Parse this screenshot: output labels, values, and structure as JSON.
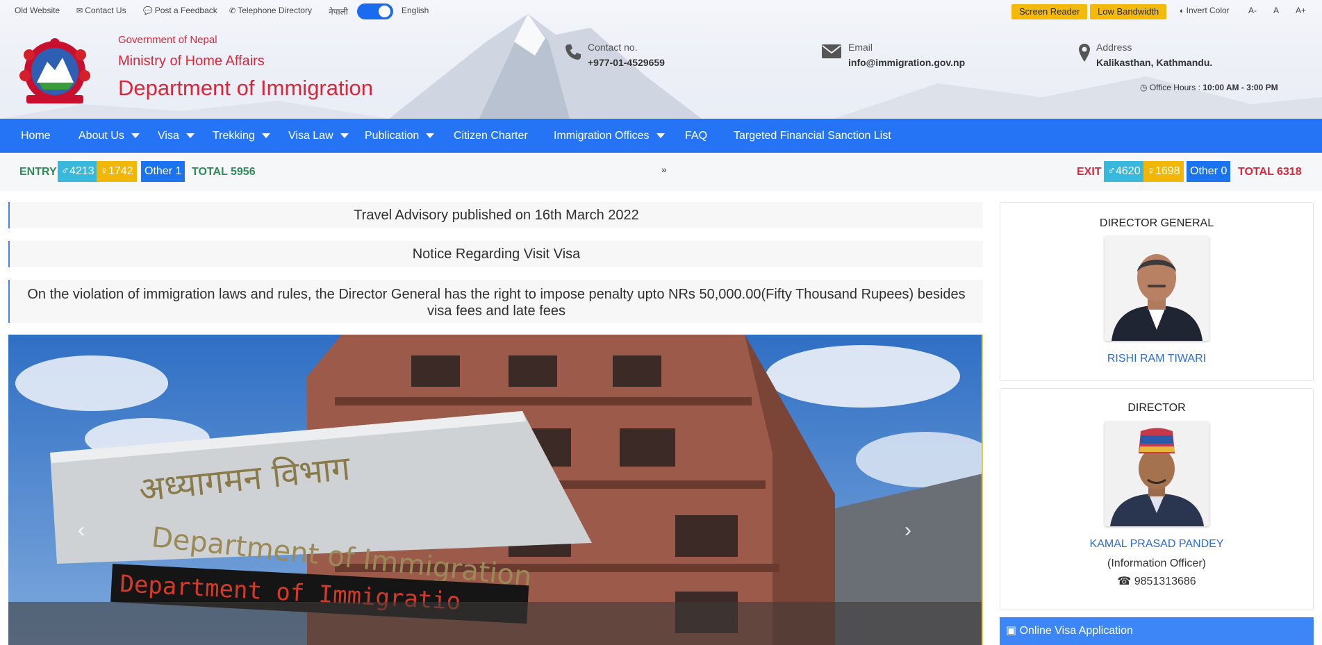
{
  "utility": {
    "old_website": "Old Website",
    "contact_us": "Contact Us",
    "feedback": "Post a Feedback",
    "telephone": "Telephone Directory",
    "lang_nepali": "नेपाली",
    "lang_english": "English",
    "screen_reader": "Screen Reader",
    "low_bandwidth": "Low Bandwidth",
    "invert_color": "Invert Color",
    "font_decrease": "A-",
    "font_normal": "A",
    "font_increase": "A+"
  },
  "brand": {
    "government": "Government of Nepal",
    "ministry": "Ministry of Home Affairs",
    "department": "Department of Immigration"
  },
  "contact": {
    "phone_label": "Contact no.",
    "phone_value": "+977-01-4529659",
    "email_label": "Email",
    "email_value": "info@immigration.gov.np",
    "address_label": "Address",
    "address_value": "Kalikasthan, Kathmandu.",
    "hours_label": "Office Hours :",
    "hours_value": "10:00 AM - 3:00 PM"
  },
  "nav": [
    {
      "label": "Home",
      "dropdown": false
    },
    {
      "label": "About Us",
      "dropdown": true
    },
    {
      "label": "Visa",
      "dropdown": true
    },
    {
      "label": "Trekking",
      "dropdown": true
    },
    {
      "label": "Visa Law",
      "dropdown": true
    },
    {
      "label": "Publication",
      "dropdown": true
    },
    {
      "label": "Citizen Charter",
      "dropdown": false
    },
    {
      "label": "Immigration Offices",
      "dropdown": true
    },
    {
      "label": "FAQ",
      "dropdown": false
    },
    {
      "label": "Targeted Financial Sanction List",
      "dropdown": false
    }
  ],
  "stats": {
    "entry_label": "ENTRY",
    "entry_male": "4213",
    "entry_female": "1742",
    "entry_other": "Other 1",
    "entry_total": "TOTAL 5956",
    "exit_label": "EXIT",
    "exit_male": "4620",
    "exit_female": "1698",
    "exit_other": "Other 0",
    "exit_total": "TOTAL 6318"
  },
  "notices": [
    "Travel Advisory published on 16th March 2022",
    "Notice Regarding Visit Visa",
    "On the violation of immigration laws and rules, the Director General has the right to impose penalty upto NRs 50,000.00(Fifty Thousand Rupees) besides visa fees and late fees"
  ],
  "slider": {
    "sign_nepali": "अध्यागमन विभाग",
    "sign_english": "Department of Immigration",
    "led_text": "Department of Immigratio"
  },
  "director_general": {
    "title": "DIRECTOR GENERAL",
    "name": "RISHI RAM TIWARI"
  },
  "director": {
    "title": "DIRECTOR",
    "name": "KAMAL PRASAD PANDEY",
    "role": "(Information Officer)",
    "phone": "9851313686"
  },
  "online_visa": "Online Visa Application",
  "colors": {
    "nav_blue": "#2574f6",
    "brand_red": "#d8263a",
    "entry_green": "#2e8b57",
    "exit_red": "#d8263a",
    "pill_yellow": "#f5b90a"
  }
}
